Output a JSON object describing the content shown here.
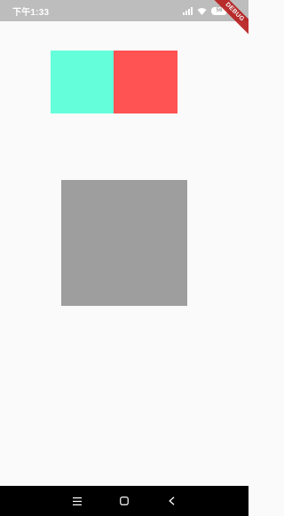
{
  "status_bar": {
    "time": "下午1:33",
    "battery_label": "56",
    "icons": [
      "signal-icon",
      "wifi-icon",
      "battery-icon"
    ]
  },
  "debug_banner": {
    "label": "DEBUG"
  },
  "boxes": {
    "cyan_color": "#64ffda",
    "red_color": "#ff5252",
    "gray_color": "#9e9e9e"
  },
  "nav_bar": {
    "buttons": [
      "menu-icon",
      "home-icon",
      "back-icon"
    ]
  }
}
